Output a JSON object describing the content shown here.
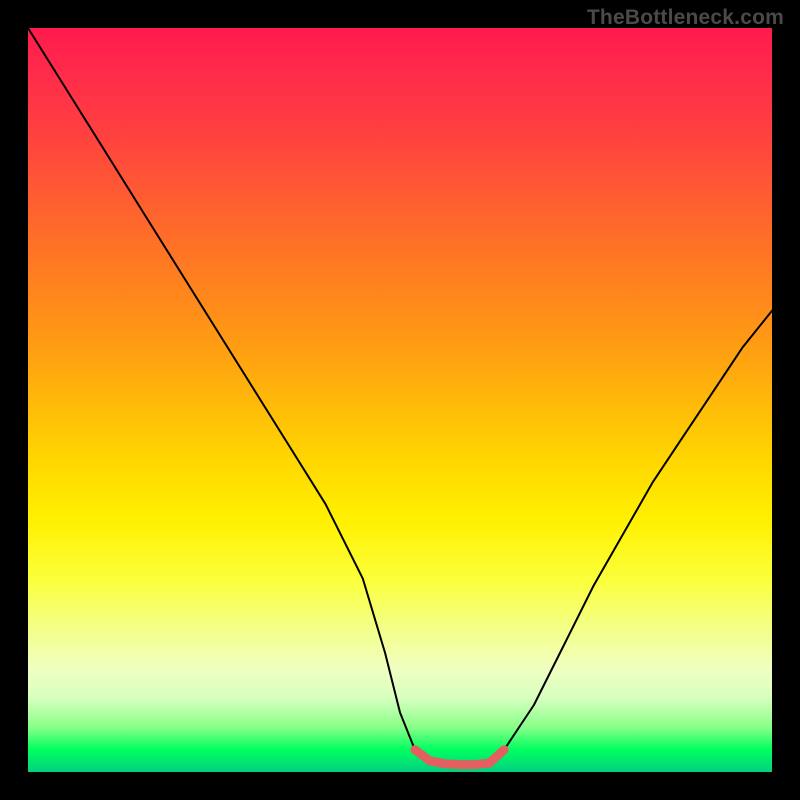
{
  "watermark": "TheBottleneck.com",
  "chart_data": {
    "type": "line",
    "title": "",
    "xlabel": "",
    "ylabel": "",
    "xlim": [
      0,
      100
    ],
    "ylim": [
      0,
      100
    ],
    "grid": false,
    "legend": null,
    "series": [
      {
        "name": "bottleneck-curve",
        "color": "#000000",
        "x": [
          0,
          5,
          10,
          15,
          20,
          25,
          30,
          35,
          40,
          45,
          48,
          50,
          52,
          55,
          58,
          60,
          62,
          64,
          68,
          72,
          76,
          80,
          84,
          88,
          92,
          96,
          100
        ],
        "y": [
          100,
          92,
          84,
          76,
          68,
          60,
          52,
          44,
          36,
          26,
          16,
          8,
          3,
          1.2,
          1.0,
          1.0,
          1.2,
          3,
          9,
          17,
          25,
          32,
          39,
          45,
          51,
          57,
          62
        ]
      },
      {
        "name": "optimal-band",
        "color": "#e26060",
        "x": [
          52,
          54,
          56,
          58,
          60,
          62,
          64
        ],
        "y": [
          3.0,
          1.5,
          1.1,
          1.0,
          1.0,
          1.2,
          3.0
        ]
      }
    ],
    "background_gradient_stops": [
      {
        "pos": 0,
        "color": "#ff1a4d"
      },
      {
        "pos": 50,
        "color": "#ffb80a"
      },
      {
        "pos": 80,
        "color": "#f4ff80"
      },
      {
        "pos": 97,
        "color": "#00ff60"
      },
      {
        "pos": 100,
        "color": "#00d080"
      }
    ]
  }
}
